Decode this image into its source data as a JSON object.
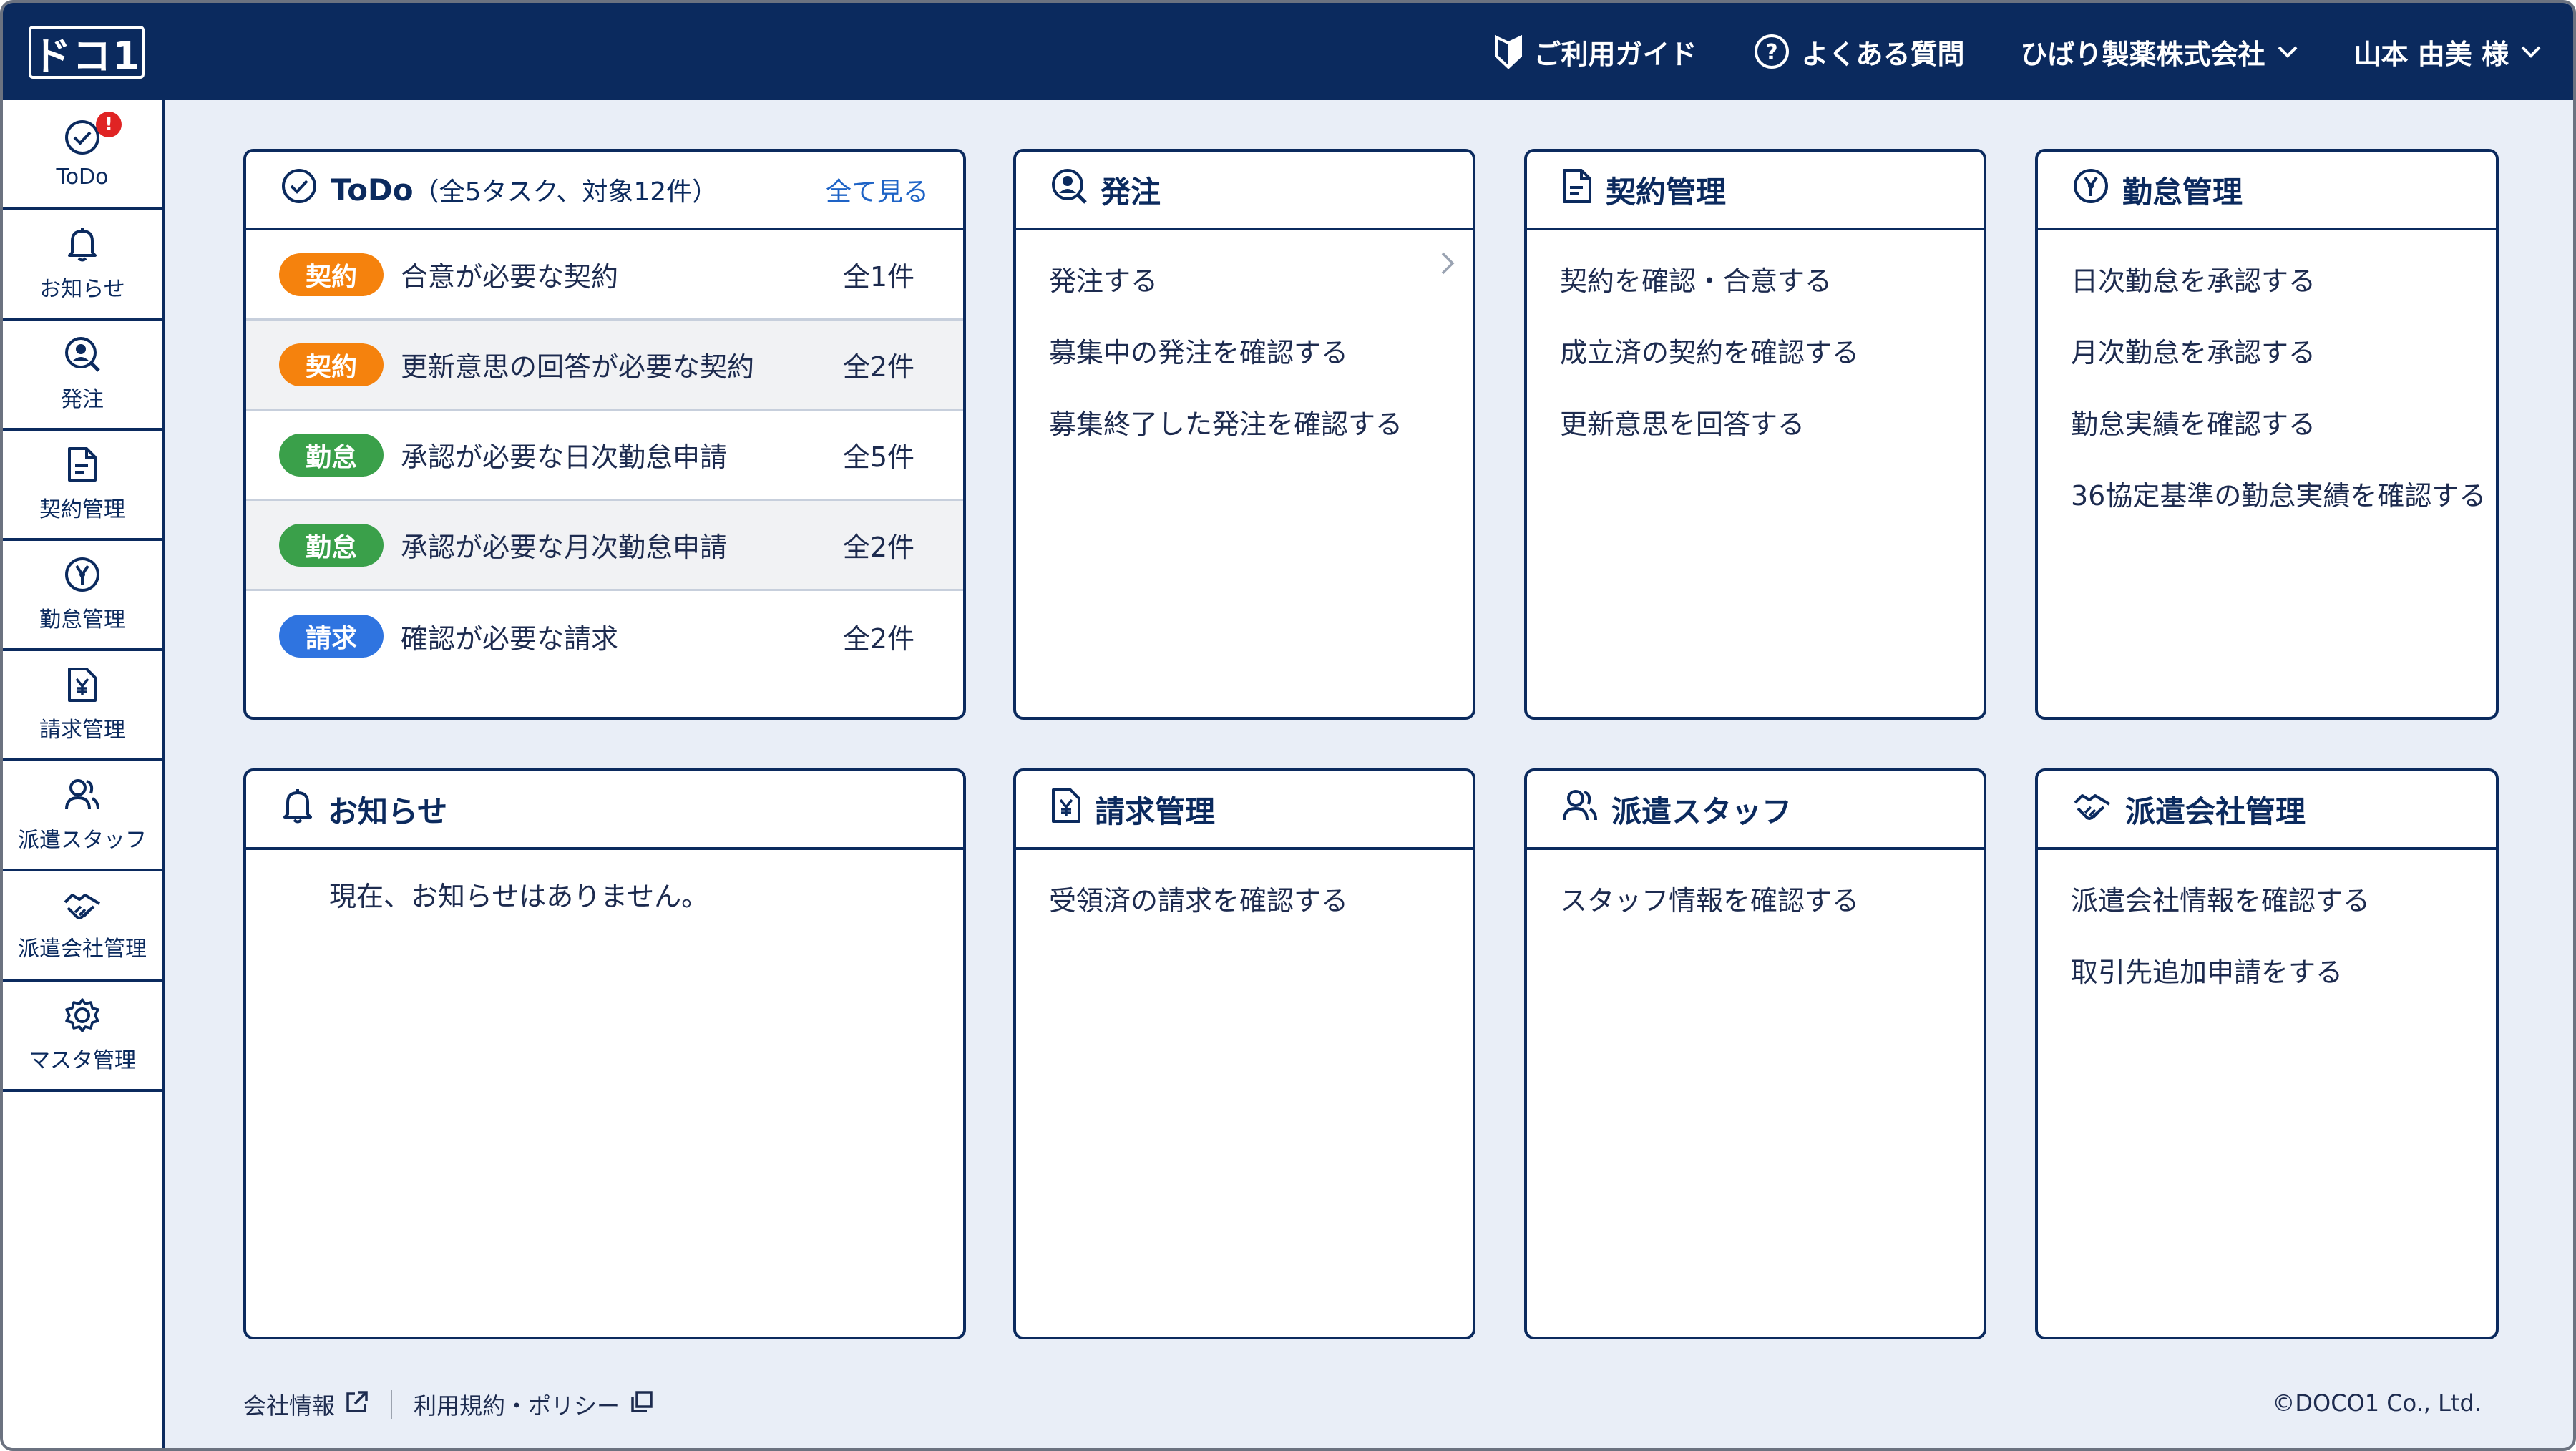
{
  "header": {
    "logo": "ドコ1",
    "nav": [
      {
        "label": "ご利用ガイド",
        "icon": "guide-shield-icon"
      },
      {
        "label": "よくある質問",
        "icon": "question-circle-icon"
      },
      {
        "label": "ひばり製薬株式会社",
        "icon": "chevron-down-icon"
      },
      {
        "label": "山本 由美 様",
        "icon": "chevron-down-icon"
      }
    ]
  },
  "sidebar": {
    "items": [
      {
        "label": "ToDo",
        "icon": "check-circle-icon",
        "badge": "!"
      },
      {
        "label": "お知らせ",
        "icon": "bell-icon"
      },
      {
        "label": "発注",
        "icon": "order-search-icon"
      },
      {
        "label": "契約管理",
        "icon": "document-icon"
      },
      {
        "label": "勤怠管理",
        "icon": "attendance-icon"
      },
      {
        "label": "請求管理",
        "icon": "invoice-yen-icon"
      },
      {
        "label": "派遣スタッフ",
        "icon": "staff-icon"
      },
      {
        "label": "派遣会社管理",
        "icon": "handshake-icon"
      },
      {
        "label": "マスタ管理",
        "icon": "gear-icon"
      }
    ]
  },
  "todo": {
    "title": "ToDo",
    "subtitle": "（全5タスク、対象12件）",
    "see_all": "全て見る",
    "rows": [
      {
        "tag": "契約",
        "tag_color": "#f5820d",
        "label": "合意が必要な契約",
        "count": "全1件"
      },
      {
        "tag": "契約",
        "tag_color": "#f5820d",
        "label": "更新意思の回答が必要な契約",
        "count": "全2件"
      },
      {
        "tag": "勤怠",
        "tag_color": "#3aa04a",
        "label": "承認が必要な日次勤怠申請",
        "count": "全5件"
      },
      {
        "tag": "勤怠",
        "tag_color": "#3aa04a",
        "label": "承認が必要な月次勤怠申請",
        "count": "全2件"
      },
      {
        "tag": "請求",
        "tag_color": "#2f74e0",
        "label": "確認が必要な請求",
        "count": "全2件"
      }
    ]
  },
  "cards": {
    "order": {
      "title": "発注",
      "links": [
        "発注する",
        "募集中の発注を確認する",
        "募集終了した発注を確認する"
      ]
    },
    "contract": {
      "title": "契約管理",
      "links": [
        "契約を確認・合意する",
        "成立済の契約を確認する",
        "更新意思を回答する"
      ]
    },
    "attendance": {
      "title": "勤怠管理",
      "links": [
        "日次勤怠を承認する",
        "月次勤怠を承認する",
        "勤怠実績を確認する",
        "36協定基準の勤怠実績を確認する"
      ]
    },
    "notice": {
      "title": "お知らせ",
      "empty": "現在、お知らせはありません。"
    },
    "billing": {
      "title": "請求管理",
      "links": [
        "受領済の請求を確認する"
      ]
    },
    "staff": {
      "title": "派遣スタッフ",
      "links": [
        "スタッフ情報を確認する"
      ]
    },
    "agency": {
      "title": "派遣会社管理",
      "links": [
        "派遣会社情報を確認する",
        "取引先追加申請をする"
      ]
    }
  },
  "footer": {
    "company_info": "会社情報",
    "terms": "利用規約・ポリシー",
    "copyright": "©DOCO1 Co., Ltd."
  }
}
